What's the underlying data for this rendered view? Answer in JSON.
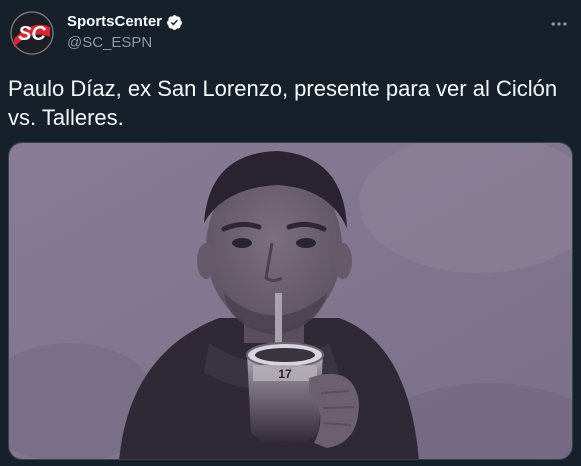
{
  "account": {
    "display_name": "SportsCenter",
    "handle": "@SC_ESPN",
    "verified": true,
    "avatar_icon": "sportscenter-logo-icon",
    "avatar_logo_text": "SC"
  },
  "tweet": {
    "text": "Paulo Díaz, ex San Lorenzo, presente para ver al Ciclón vs. Talleres."
  },
  "media": {
    "type": "photo",
    "mate_cup_marking": "17"
  },
  "colors": {
    "background": "#15202b",
    "text_primary": "#f7f9f9",
    "text_secondary": "#8b98a5",
    "verified_badge": "#f7f9f9",
    "logo_red": "#e0242b",
    "photo_tint": "#8a7d97"
  },
  "icons": {
    "verified": "verified-badge-icon",
    "more": "more-options-icon"
  }
}
